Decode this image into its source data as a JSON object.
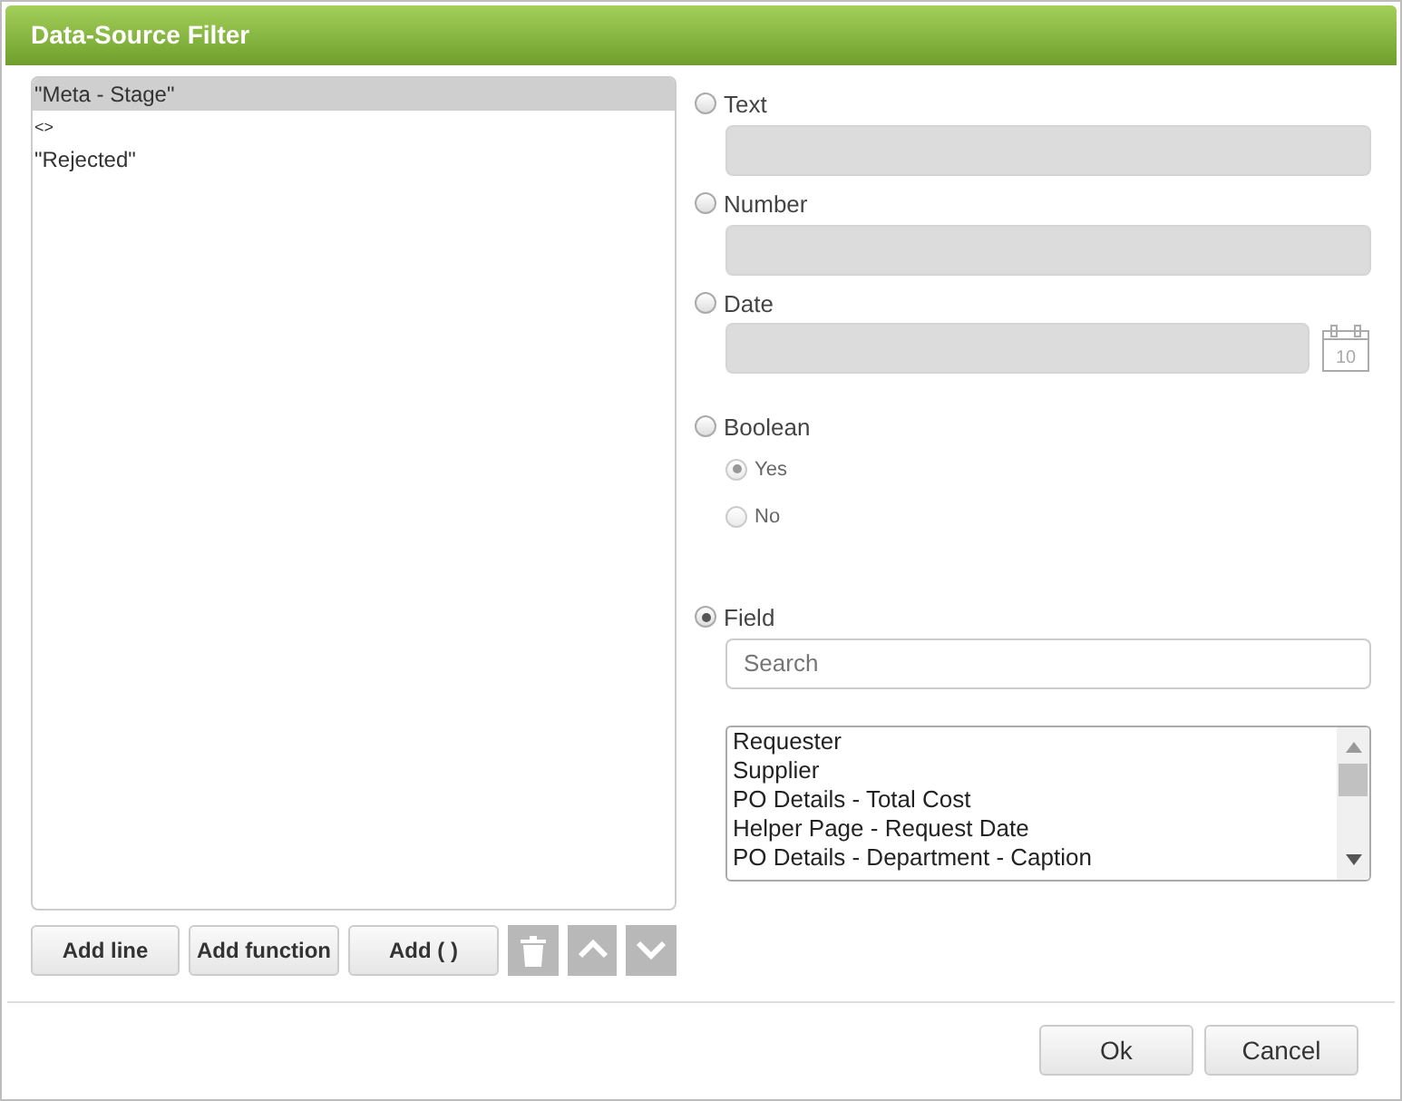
{
  "window": {
    "title": "Data-Source Filter"
  },
  "expression_lines": [
    {
      "text": "\"Meta - Stage\"",
      "selected": true,
      "kind": "field"
    },
    {
      "text": "<>",
      "selected": false,
      "kind": "operator"
    },
    {
      "text": "\"Rejected\"",
      "selected": false,
      "kind": "value"
    }
  ],
  "left_buttons": [
    "Add line",
    "Add function",
    "Add ( )"
  ],
  "value_types": [
    {
      "label": "Text",
      "kind": "text",
      "selected": false
    },
    {
      "label": "Number",
      "kind": "number",
      "selected": false
    },
    {
      "label": "Date",
      "kind": "date",
      "selected": false,
      "calendar_day": "10"
    },
    {
      "label": "Boolean",
      "kind": "boolean",
      "selected": false,
      "options": [
        {
          "label": "Yes",
          "selected": true,
          "disabled": true
        },
        {
          "label": "No",
          "selected": false,
          "disabled": true
        }
      ]
    },
    {
      "label": "Field",
      "kind": "field",
      "selected": true,
      "search": {
        "placeholder": "Search"
      },
      "fields": [
        "Requester",
        "Supplier",
        "PO Details - Total Cost",
        "Helper Page - Request Date",
        "PO Details - Department - Caption"
      ]
    }
  ],
  "footer_buttons": [
    "Ok",
    "Cancel"
  ]
}
